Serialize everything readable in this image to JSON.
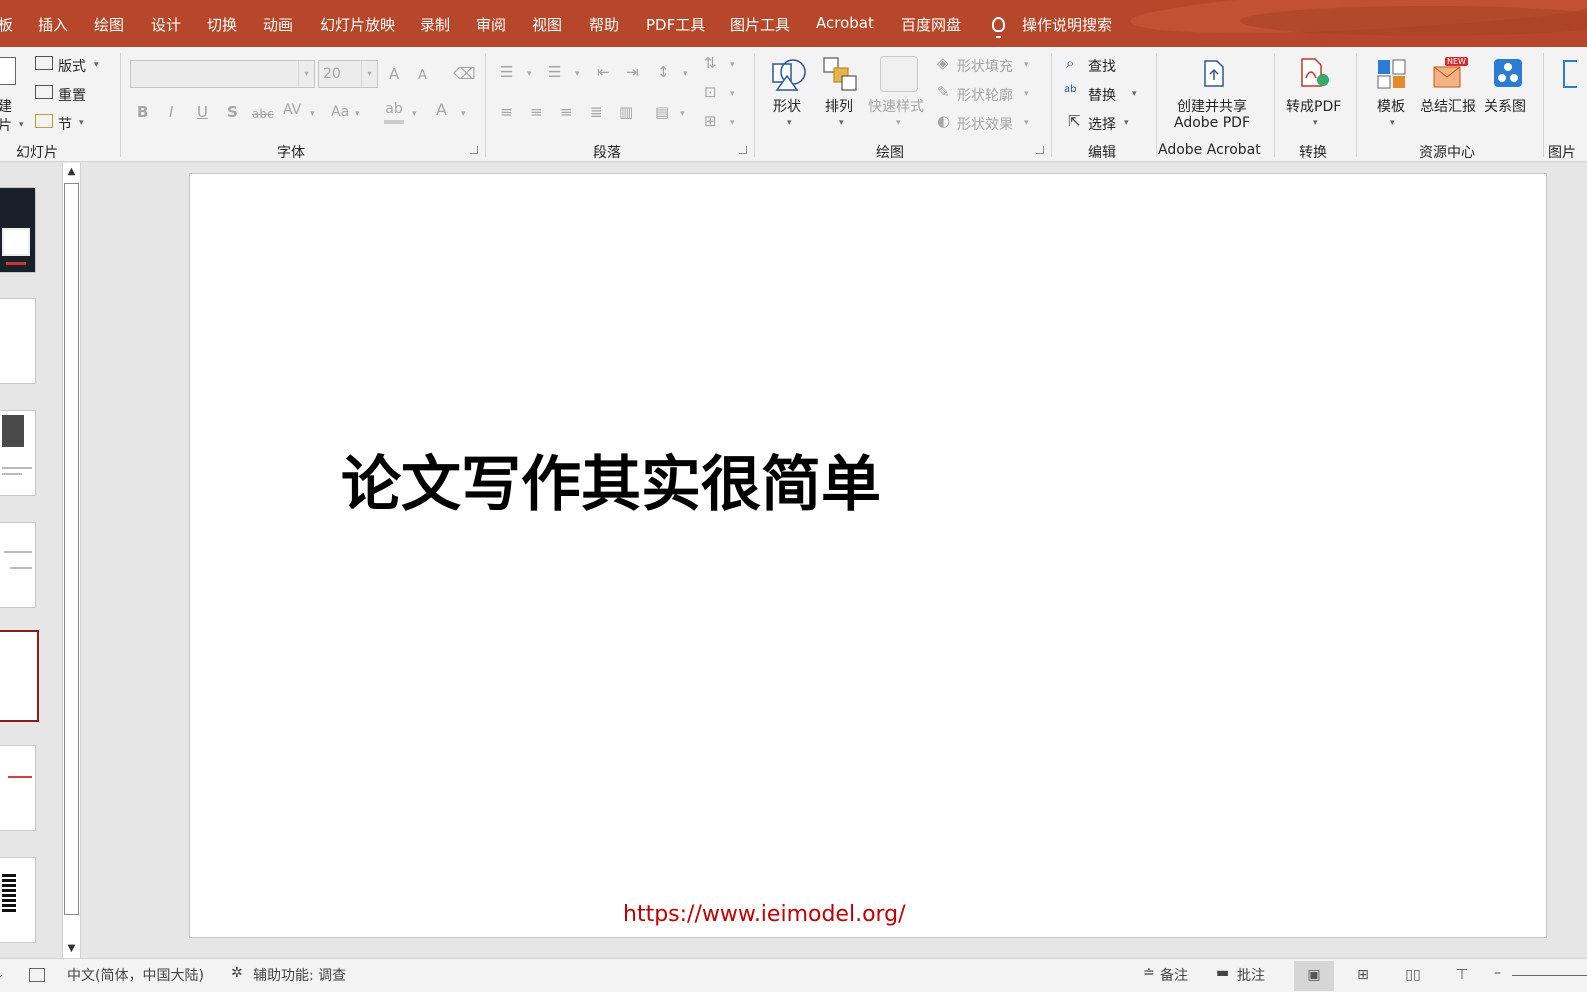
{
  "menubar": {
    "tabs": [
      "板",
      "插入",
      "绘图",
      "设计",
      "切换",
      "动画",
      "幻灯片放映",
      "录制",
      "审阅",
      "视图",
      "帮助",
      "PDF工具",
      "图片工具",
      "Acrobat",
      "百度网盘"
    ],
    "search_label": "操作说明搜索"
  },
  "ribbon": {
    "slides_group": {
      "new_slide_partial": "建",
      "new_slide_partial2": "片",
      "layout": "版式",
      "reset": "重置",
      "section": "节",
      "label": "幻灯片"
    },
    "font_group": {
      "font_size": "20",
      "bold": "B",
      "italic": "I",
      "underline": "U",
      "shadow": "S",
      "strike": "abc",
      "spacing": "AV",
      "case": "Aa",
      "grow": "A",
      "shrink": "A",
      "color": "A",
      "label": "字体"
    },
    "paragraph_group": {
      "label": "段落"
    },
    "drawing_group": {
      "shapes": "形状",
      "arrange": "排列",
      "quick_styles": "快速样式",
      "fill": "形状填充",
      "outline": "形状轮廓",
      "effects": "形状效果",
      "label": "绘图"
    },
    "editing_group": {
      "find": "查找",
      "replace": "替换",
      "select": "选择",
      "label": "编辑"
    },
    "acrobat_group": {
      "create_share_line1": "创建并共享",
      "create_share_line2": "Adobe PDF",
      "label": "Adobe Acrobat"
    },
    "convert_group": {
      "to_pdf": "转成PDF",
      "label": "转换"
    },
    "resource_group": {
      "template": "模板",
      "summary": "总结汇报",
      "relation": "关系图",
      "new_badge": "NEW",
      "label": "资源中心"
    },
    "picture_group_partial": "图片"
  },
  "slide": {
    "title": "论文写作其实很简单",
    "url": "https://www.ieimodel.org/"
  },
  "statusbar": {
    "language": "中文(简体，中国大陆)",
    "accessibility": "辅助功能: 调查",
    "notes": "备注",
    "comments": "批注"
  },
  "colors": {
    "menubar_bg": "#b7472a",
    "url_red": "#c00000",
    "selected_thumb_border": "#8b1c1c"
  }
}
